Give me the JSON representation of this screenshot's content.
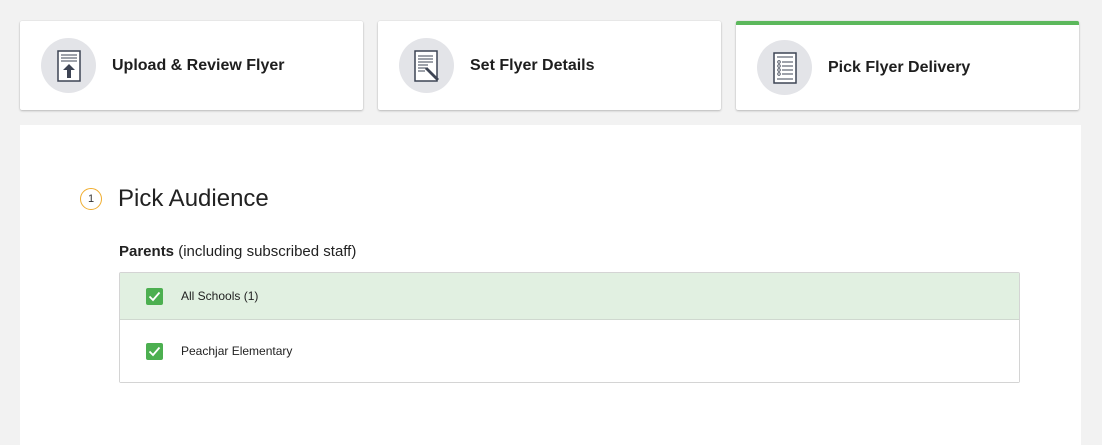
{
  "steps": [
    {
      "label": "Upload & Review Flyer",
      "icon": "upload-flyer-icon",
      "active": false
    },
    {
      "label": "Set Flyer Details",
      "icon": "edit-document-icon",
      "active": false
    },
    {
      "label": "Pick Flyer Delivery",
      "icon": "list-document-icon",
      "active": true
    }
  ],
  "colors": {
    "active_accent": "#5cb85c",
    "badge_border": "#f0ad2e",
    "checkbox": "#4caf50",
    "selected_row_bg": "#e1f0e1"
  },
  "section": {
    "number": "1",
    "title": "Pick Audience"
  },
  "audience": {
    "label_bold": "Parents",
    "label_rest": " (including subscribed staff)"
  },
  "schools": [
    {
      "name": "All Schools (1)",
      "checked": true
    },
    {
      "name": "Peachjar Elementary",
      "checked": true
    }
  ]
}
